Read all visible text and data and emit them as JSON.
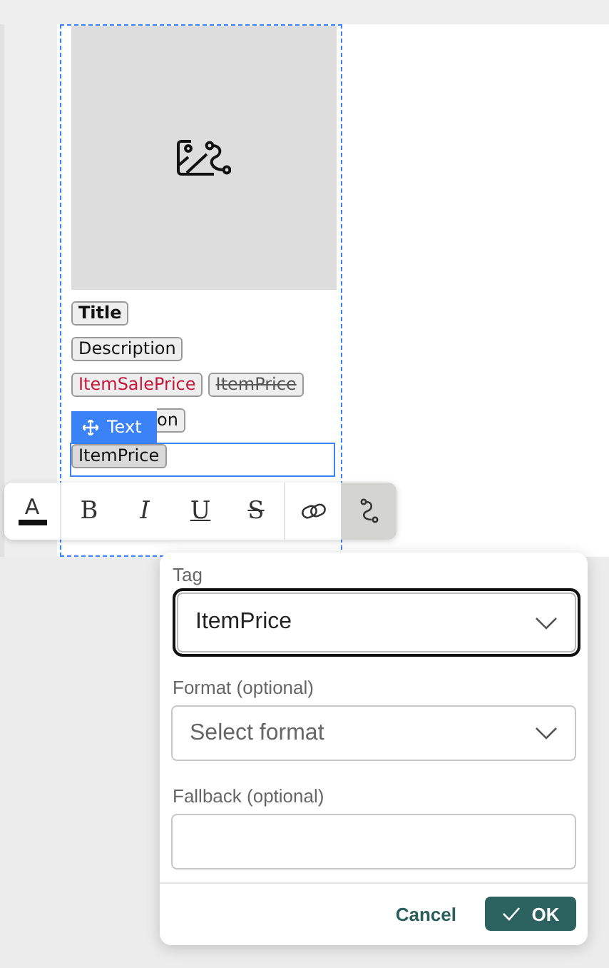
{
  "template_card": {
    "rows": [
      {
        "selected": false,
        "chips": [
          {
            "text": "Title",
            "kind": "bold"
          }
        ]
      },
      {
        "selected": false,
        "chips": [
          {
            "text": "Description",
            "kind": "plain"
          }
        ]
      },
      {
        "selected": false,
        "chips": [
          {
            "text": "ItemSalePrice",
            "kind": "sale"
          },
          {
            "text": "ItemPrice",
            "kind": "strike"
          }
        ]
      },
      {
        "selected": false,
        "chips": [
          {
            "text": "on",
            "kind": "partial"
          }
        ]
      },
      {
        "selected": true,
        "badge": "Text",
        "chips": [
          {
            "text": "ItemPrice",
            "kind": "plain"
          }
        ]
      }
    ]
  },
  "toolbar": {
    "groups": [
      [
        {
          "kind": "color",
          "label": "A",
          "selected": false
        }
      ],
      [
        {
          "kind": "bold",
          "label": "B",
          "selected": false
        },
        {
          "kind": "italic",
          "label": "I",
          "selected": false
        },
        {
          "kind": "underline",
          "label": "U",
          "selected": false
        },
        {
          "kind": "strike",
          "label": "S",
          "selected": false
        }
      ],
      [
        {
          "kind": "link",
          "selected": false
        },
        {
          "kind": "merge-tag",
          "selected": true
        }
      ]
    ]
  },
  "merge_tag_popover": {
    "fields": [
      {
        "kind": "select",
        "label": "Tag",
        "value": "ItemPrice",
        "focused": true
      },
      {
        "kind": "select",
        "label": "Format (optional)",
        "placeholder": "Select format",
        "focused": false
      },
      {
        "kind": "input",
        "label": "Fallback (optional)",
        "focused": false
      }
    ],
    "buttons": [
      {
        "kind": "cancel",
        "label": "Cancel"
      },
      {
        "kind": "ok",
        "label": "OK"
      }
    ]
  }
}
